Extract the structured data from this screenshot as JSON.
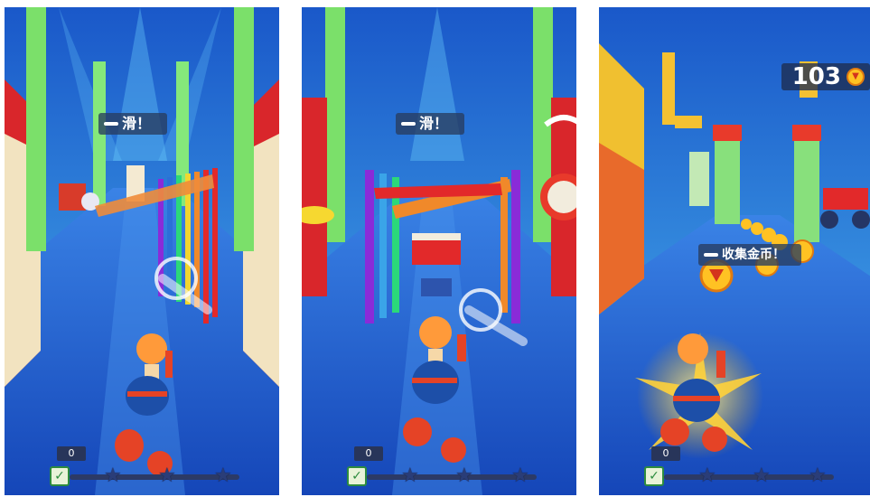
{
  "panels": [
    {
      "id": "panel-1",
      "instruction": "滑！",
      "score": "0"
    },
    {
      "id": "panel-2",
      "instruction": "滑！",
      "score": "0"
    },
    {
      "id": "panel-3",
      "instruction": "收集金币！",
      "score": "0",
      "coin_count": "103"
    }
  ],
  "icons": {
    "coin": "coin-icon",
    "leaf": "leaf-icon",
    "star": "star-icon",
    "hand": "swipe-hand-icon"
  },
  "colors": {
    "floor": "#1f5fd6",
    "sky": "#2f8fe8",
    "pillar": "#7be06a",
    "wall_red": "#d9262b",
    "wall_cream": "#f2e3c0",
    "character_body": "#ff9a3a",
    "character_suit": "#1d4fa8",
    "coin": "#ffc223",
    "hud_bg": "#28355a"
  }
}
